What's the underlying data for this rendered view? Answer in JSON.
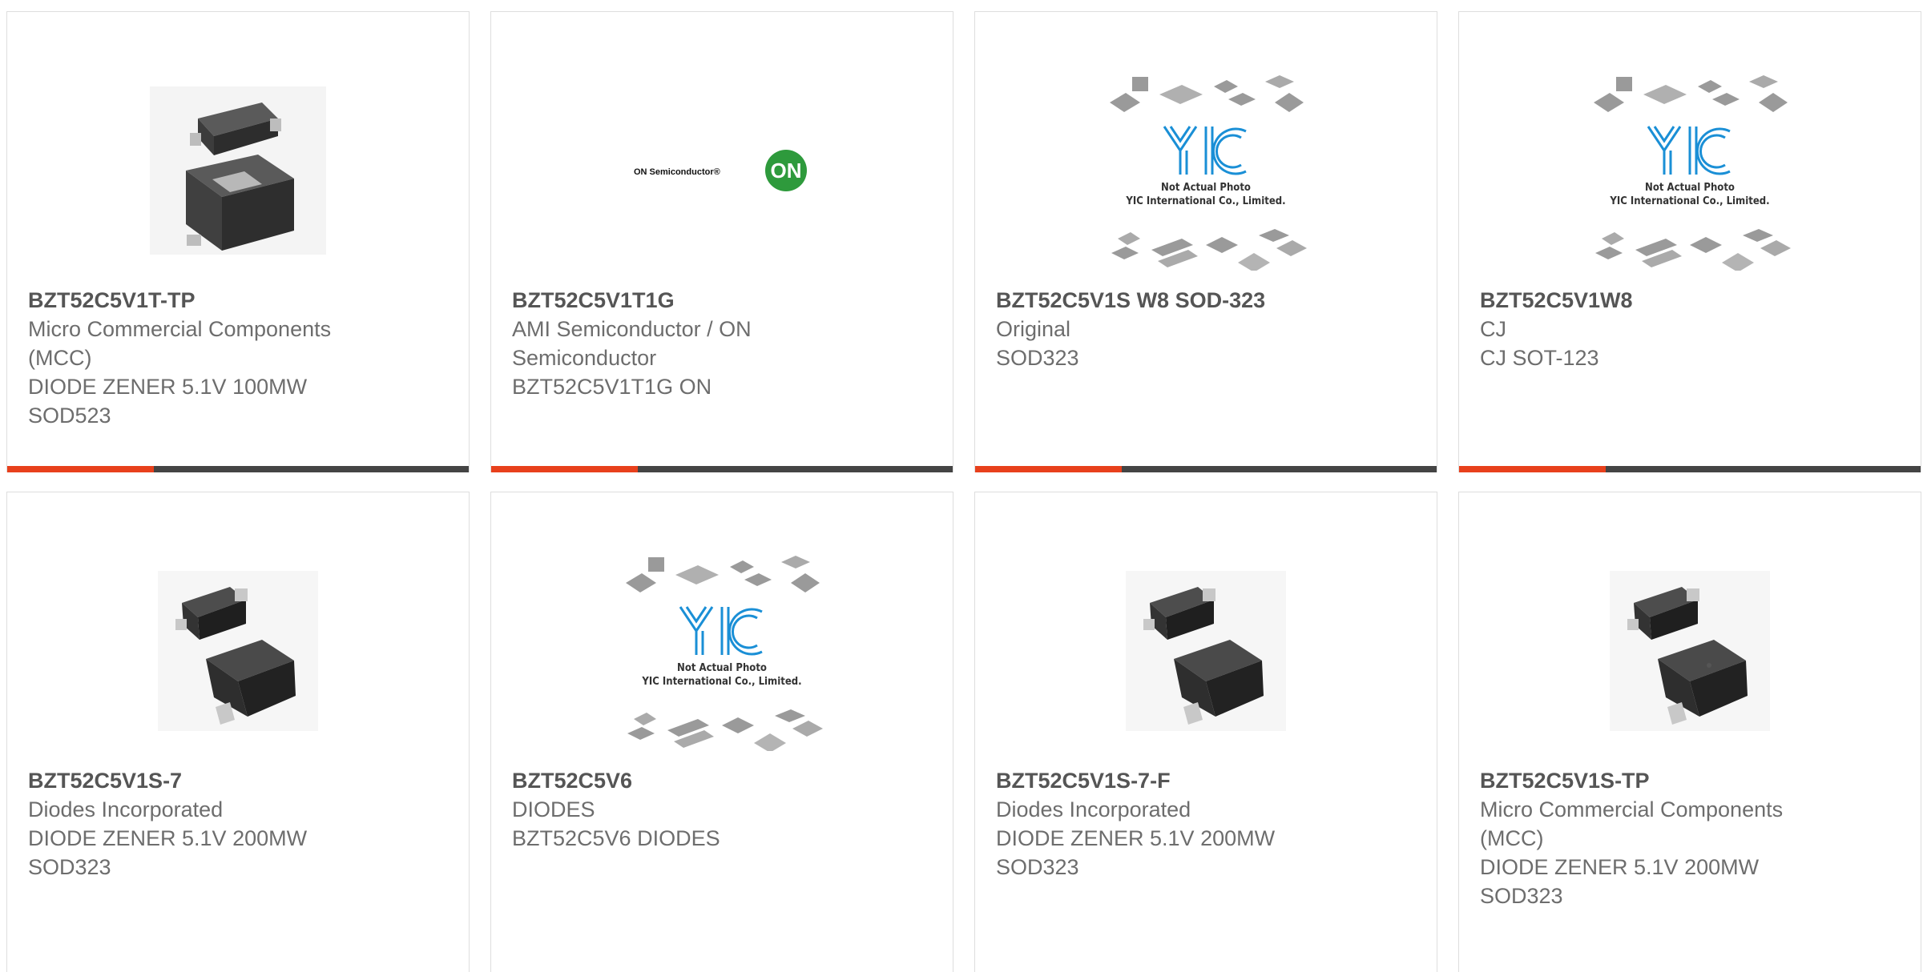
{
  "colors": {
    "accent": "#e8401c",
    "bar": "#444444",
    "border": "#dedede",
    "yic_blue": "#1a8fd6",
    "on_green": "#2e9a3c"
  },
  "products": [
    {
      "part": "BZT52C5V1T-TP",
      "lines": [
        "Micro Commercial Components",
        "(MCC)",
        "DIODE ZENER 5.1V 100MW",
        "SOD523"
      ],
      "image": "sod523-package"
    },
    {
      "part": "BZT52C5V1T1G",
      "lines": [
        "AMI Semiconductor / ON",
        "Semiconductor",
        "BZT52C5V1T1G ON"
      ],
      "image": "on-semiconductor-logo",
      "logo_text": "ON Semiconductor®",
      "logo_badge": "ON"
    },
    {
      "part": "BZT52C5V1S W8 SOD-323",
      "lines": [
        "Original",
        "SOD323"
      ],
      "image": "yic-placeholder",
      "yic_line1": "Not Actual Photo",
      "yic_line2": "YIC International Co., Limited."
    },
    {
      "part": "BZT52C5V1W8",
      "lines": [
        "CJ",
        "CJ SOT-123"
      ],
      "image": "yic-placeholder",
      "yic_line1": "Not Actual Photo",
      "yic_line2": "YIC International Co., Limited."
    },
    {
      "part": "BZT52C5V1S-7",
      "lines": [
        "Diodes Incorporated",
        "DIODE ZENER 5.1V 200MW",
        "SOD323"
      ],
      "image": "sod323-package"
    },
    {
      "part": "BZT52C5V6",
      "lines": [
        "DIODES",
        "BZT52C5V6 DIODES"
      ],
      "image": "yic-placeholder",
      "yic_line1": "Not Actual Photo",
      "yic_line2": "YIC International Co., Limited."
    },
    {
      "part": "BZT52C5V1S-7-F",
      "lines": [
        "Diodes Incorporated",
        "DIODE ZENER 5.1V 200MW",
        "SOD323"
      ],
      "image": "sod323-package"
    },
    {
      "part": "BZT52C5V1S-TP",
      "lines": [
        "Micro Commercial Components",
        "(MCC)",
        "DIODE ZENER 5.1V 200MW",
        "SOD323"
      ],
      "image": "sod323-package"
    }
  ]
}
